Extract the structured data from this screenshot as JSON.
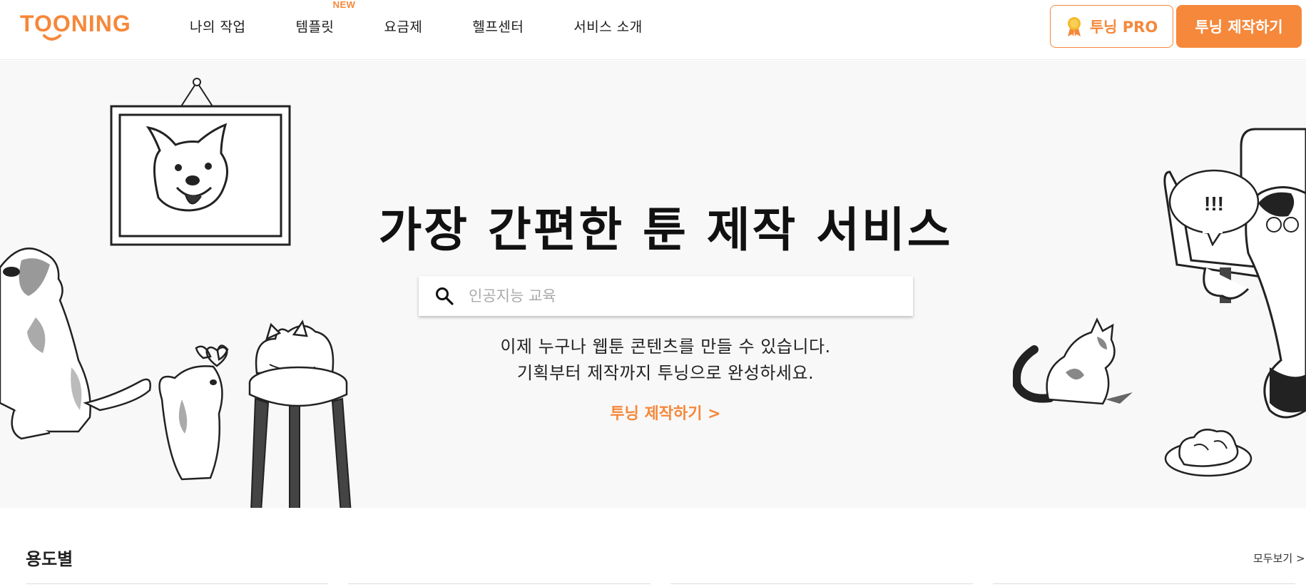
{
  "header": {
    "logo_text": "TOONING",
    "nav": [
      {
        "label": "나의 작업"
      },
      {
        "label": "템플릿",
        "badge": "NEW"
      },
      {
        "label": "요금제"
      },
      {
        "label": "헬프센터"
      },
      {
        "label": "서비스 소개"
      }
    ],
    "pro_button_label": "투닝 PRO",
    "make_button_label": "투닝 제작하기"
  },
  "hero": {
    "title": "가장 간편한 툰 제작 서비스",
    "search_placeholder": "인공지능 교육",
    "subtitle_line1": "이제 누구나 웹툰 콘텐츠를 만들 수 있습니다.",
    "subtitle_line2": "기획부터 제작까지 투닝으로 완성하세요.",
    "cta_label": "투닝 제작하기 >",
    "speech_text": "!!!"
  },
  "section": {
    "title": "용도별",
    "see_all_label": "모두보기 >"
  },
  "colors": {
    "accent": "#f5883a",
    "hero_bg": "#f8f8f8"
  }
}
